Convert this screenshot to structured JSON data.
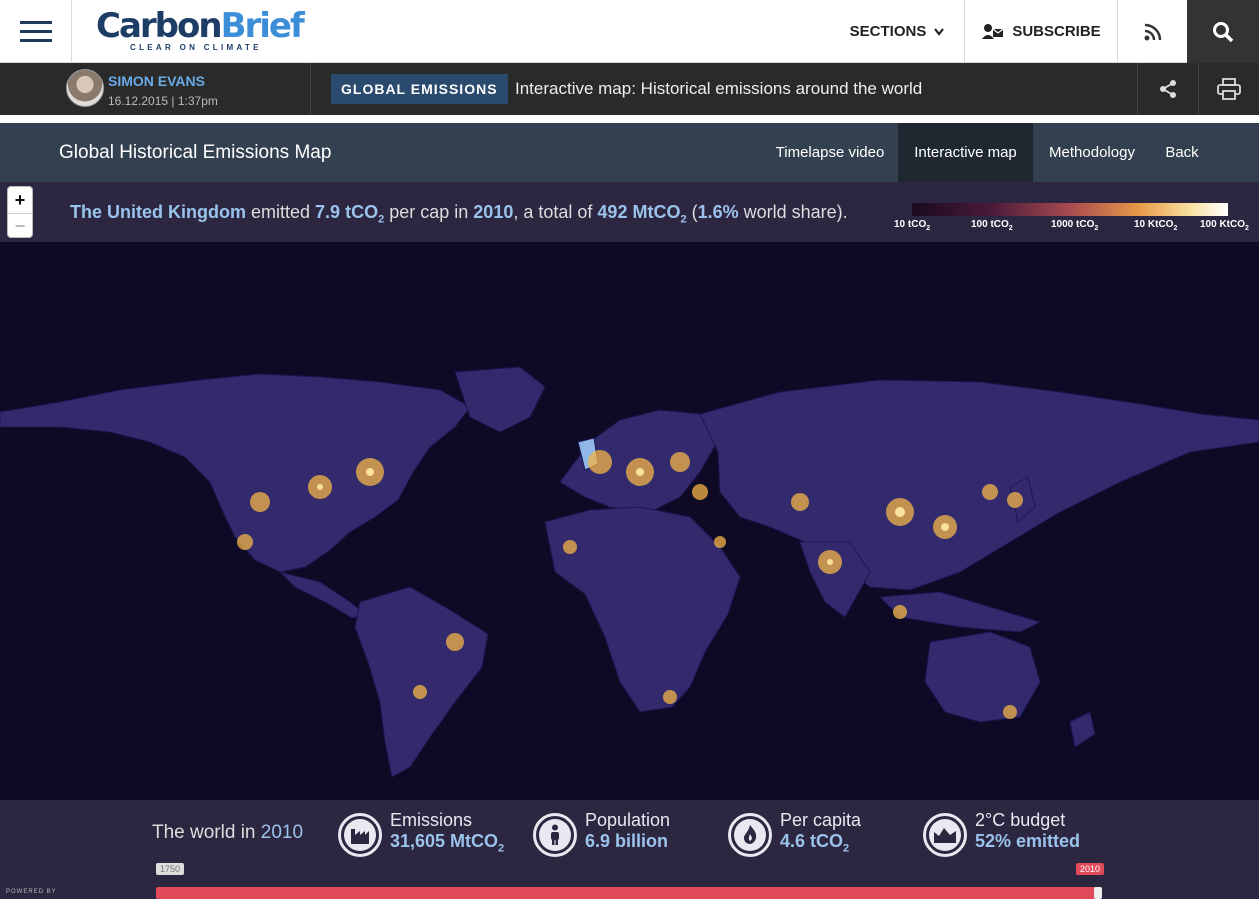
{
  "header": {
    "logo_carbon": "Carbon",
    "logo_brief": "Brief",
    "logo_tagline": "CLEAR ON CLIMATE",
    "sections_label": "SECTIONS",
    "subscribe_label": "SUBSCRIBE",
    "icons": [
      "menu-icon",
      "chevron-down-icon",
      "subscribe-icon",
      "rss-icon",
      "search-icon"
    ]
  },
  "article": {
    "author": "SIMON EVANS",
    "date": "16.12.2015 | 1:37pm",
    "category": "GLOBAL EMISSIONS",
    "title": "Interactive map: Historical emissions around the world",
    "icons": [
      "share-icon",
      "print-icon"
    ]
  },
  "map_nav": {
    "title": "Global Historical Emissions Map",
    "tabs": [
      {
        "label": "Timelapse video",
        "active": false
      },
      {
        "label": "Interactive map",
        "active": true
      },
      {
        "label": "Methodology",
        "active": false
      },
      {
        "label": "Back",
        "active": false
      }
    ]
  },
  "info": {
    "country": "The United Kingdom",
    "emitted": "emitted",
    "per_cap_value": "7.9 tCO",
    "per_cap_sub": "2",
    "per_cap_text": "per cap in",
    "year": "2010",
    "total_text": ", a total of",
    "total_value": "492 MtCO",
    "total_sub": "2",
    "share_value": "1.6%",
    "share_text": "world share).",
    "open_paren": "(",
    "zoom_in": "+",
    "zoom_out": "−"
  },
  "legend": {
    "labels": [
      {
        "text": "10 tCO",
        "sub": "2"
      },
      {
        "text": "100 tCO",
        "sub": "2"
      },
      {
        "text": "1000 tCO",
        "sub": "2"
      },
      {
        "text": "10 KtCO",
        "sub": "2"
      },
      {
        "text": "100 KtCO",
        "sub": "2"
      }
    ],
    "colors": [
      "#1a0a20",
      "#4a1a3a",
      "#a84a50",
      "#e89a48",
      "#f8e0a0",
      "#ffffff"
    ]
  },
  "stats": {
    "world_prefix": "The world in",
    "world_year": "2010",
    "items": [
      {
        "label": "Emissions",
        "value": "31,605 MtCO",
        "sub": "2",
        "icon": "factory-icon"
      },
      {
        "label": "Population",
        "value": "6.9 billion",
        "sub": "",
        "icon": "person-icon"
      },
      {
        "label": "Per capita",
        "value": "4.6 tCO",
        "sub": "2",
        "icon": "flame-icon"
      },
      {
        "label": "2°C budget",
        "value": "52% emitted",
        "sub": "",
        "icon": "budget-icon"
      }
    ]
  },
  "timeline": {
    "start_year": "1750",
    "end_year": "2010",
    "position": 1.0
  },
  "footer": {
    "powered_by": "POWERED BY"
  },
  "colors": {
    "map_bg": "#0e0a26",
    "land": "#332a6e",
    "hotspot": "#f4b446",
    "accent_blue": "#9ac3ec",
    "slider": "#e04a5a"
  }
}
